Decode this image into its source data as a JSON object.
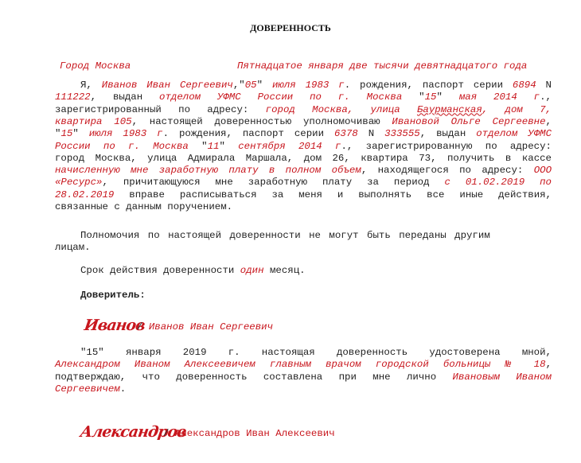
{
  "document": {
    "title": "ДОВЕРЕННОСТЬ",
    "city": "Город Москва",
    "date_words": "Пятнадцатое января две тысячи девятнадцатого года",
    "paragraph1": {
      "lines": [
        [
          {
            "t": "Я, ",
            "c": "n"
          },
          {
            "t": "Иванов Иван Сергеевич",
            "c": "r"
          },
          {
            "t": ",\"",
            "c": "n"
          },
          {
            "t": "05",
            "c": "r"
          },
          {
            "t": "\" ",
            "c": "n"
          },
          {
            "t": "июля 1983 г",
            "c": "r"
          },
          {
            "t": ". рождения, паспорт серии ",
            "c": "n"
          },
          {
            "t": "6894",
            "c": "r"
          },
          {
            "t": " N",
            "c": "n"
          }
        ],
        [
          {
            "t": "111222",
            "c": "r"
          },
          {
            "t": ", выдан ",
            "c": "n"
          },
          {
            "t": "отделом УФМС России по г. Москва",
            "c": "r"
          },
          {
            "t": " \"",
            "c": "n"
          },
          {
            "t": "15",
            "c": "r"
          },
          {
            "t": "\" ",
            "c": "n"
          },
          {
            "t": "мая 2014 г",
            "c": "r"
          },
          {
            "t": ".,",
            "c": "n"
          }
        ],
        [
          {
            "t": "зарегистрированный по адресу: ",
            "c": "n"
          },
          {
            "t": "город Москва, улица ",
            "c": "r"
          },
          {
            "t": "Баурманская",
            "c": "rw"
          },
          {
            "t": ", дом 7,",
            "c": "r"
          }
        ],
        [
          {
            "t": "квартира 105",
            "c": "r"
          },
          {
            "t": ", настоящей доверенностью уполномочиваю ",
            "c": "n"
          },
          {
            "t": "Ивановой Ольге Сергеевне",
            "c": "r"
          },
          {
            "t": ",",
            "c": "n"
          }
        ],
        [
          {
            "t": "\"",
            "c": "n"
          },
          {
            "t": "15",
            "c": "r"
          },
          {
            "t": "\" ",
            "c": "n"
          },
          {
            "t": "июля 1983 г",
            "c": "r"
          },
          {
            "t": ". рождения, паспорт серии ",
            "c": "n"
          },
          {
            "t": "6378",
            "c": "r"
          },
          {
            "t": " N ",
            "c": "n"
          },
          {
            "t": "333555",
            "c": "r"
          },
          {
            "t": ", выдан ",
            "c": "n"
          },
          {
            "t": "отделом УФМС",
            "c": "r"
          }
        ],
        [
          {
            "t": "России по г. Москва",
            "c": "r"
          },
          {
            "t": " \"",
            "c": "n"
          },
          {
            "t": "11",
            "c": "r"
          },
          {
            "t": "\" ",
            "c": "n"
          },
          {
            "t": "сентября 2014 г",
            "c": "r"
          },
          {
            "t": "., зарегистрированную по адресу:",
            "c": "n"
          }
        ],
        [
          {
            "t": "город Москва, улица Адмирала Маршала, дом 26, квартира 73, получить в кассе",
            "c": "n"
          }
        ],
        [
          {
            "t": "начисленную мне заработную плату в полном объем",
            "c": "r"
          },
          {
            "t": ", находящегося по адресу: ",
            "c": "n"
          },
          {
            "t": "ООО",
            "c": "r"
          }
        ],
        [
          {
            "t": "«Ресурс»",
            "c": "r"
          },
          {
            "t": ", причитающуюся мне заработную плату за период ",
            "c": "n"
          },
          {
            "t": "с 01.02.2019 по",
            "c": "r"
          }
        ],
        [
          {
            "t": "28.02.2019",
            "c": "r"
          },
          {
            "t": " вправе расписываться за меня и выполнять все иные действия,",
            "c": "n"
          }
        ],
        [
          {
            "t": "связанные с данным поручением.",
            "c": "n"
          }
        ]
      ]
    },
    "paragraph2_line1": "Полномочия по настоящей доверенности не могут быть переданы другим",
    "paragraph2_line2": "лицам.",
    "validity": {
      "prefix": "Срок действия доверенности ",
      "value": "один",
      "suffix": " месяц."
    },
    "principal_label": "Доверитель:",
    "principal_signature": "Иванов",
    "principal_name": "Иванов Иван Сергеевич",
    "notary": {
      "lines": [
        [
          {
            "t": "\"15\" января 2019 г. настоящая доверенность удостоверена мной,",
            "c": "n"
          }
        ],
        [
          {
            "t": "Александром Иваном Алексеевичем главным врачом городской больницы № 18",
            "c": "r"
          },
          {
            "t": ",",
            "c": "n"
          }
        ],
        [
          {
            "t": "подтверждаю, что доверенность составлена при мне лично ",
            "c": "n"
          },
          {
            "t": "Ивановым Иваном",
            "c": "r"
          }
        ],
        [
          {
            "t": "Сергеевичем",
            "c": "r"
          },
          {
            "t": ".",
            "c": "n"
          }
        ]
      ]
    },
    "notary_signature": "Александров",
    "notary_name": "Александров Иван Алексеевич",
    "separator": "/"
  }
}
